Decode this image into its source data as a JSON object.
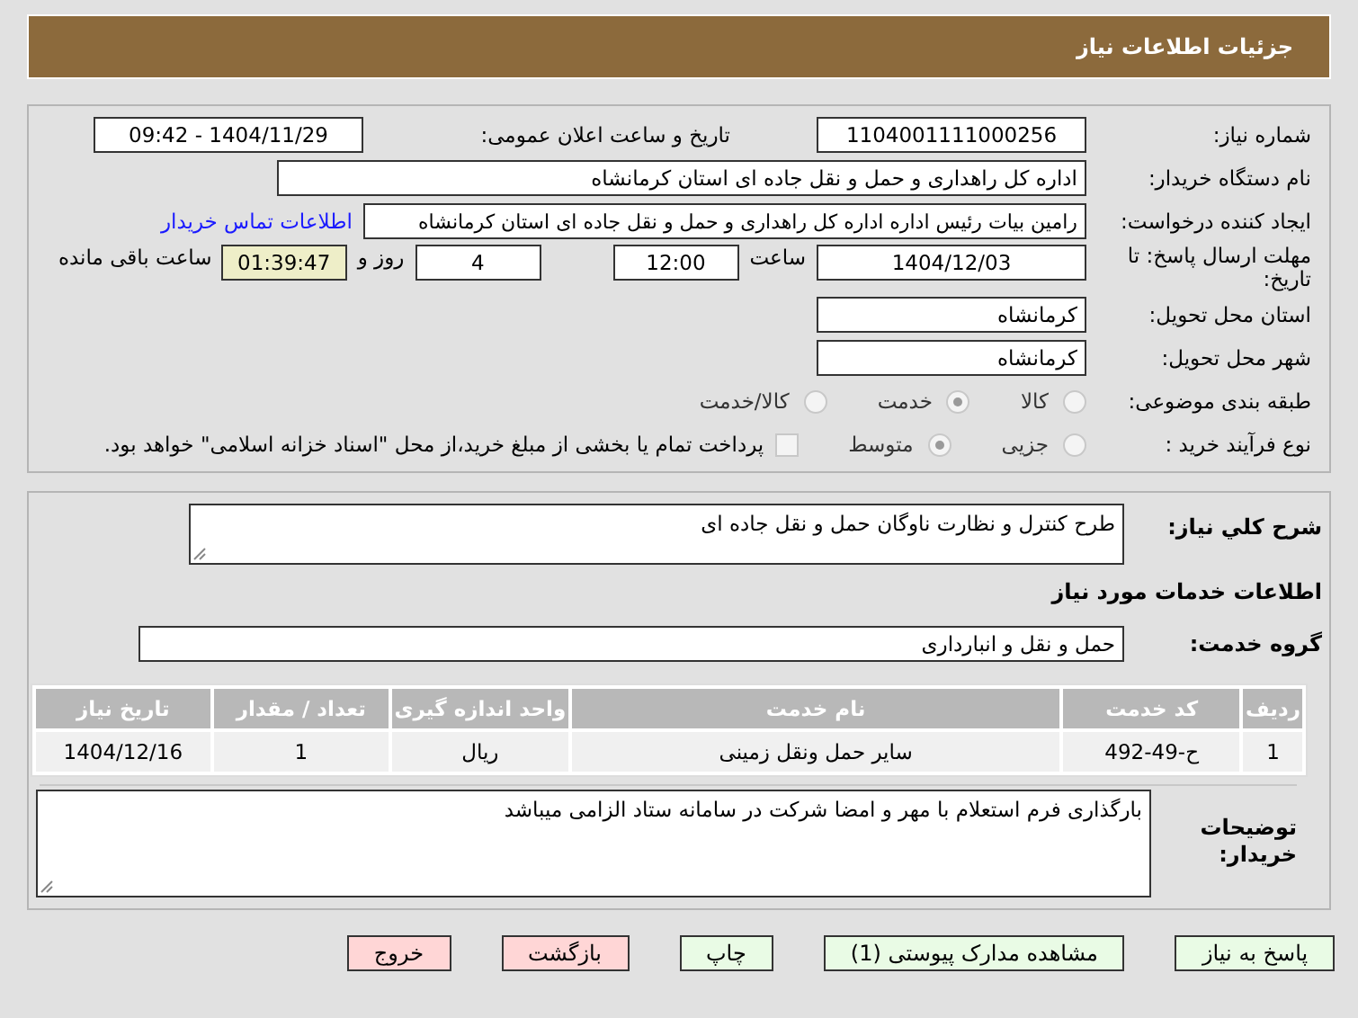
{
  "header": {
    "title": "جزئیات اطلاعات نیاز"
  },
  "details": {
    "need_number": {
      "label": "شماره نیاز:",
      "value": "1104001111000256"
    },
    "announce": {
      "label": "تاریخ و ساعت اعلان عمومی:",
      "value": "1404/11/29 - 09:42"
    },
    "buyer": {
      "label": "نام دستگاه خریدار:",
      "value": "اداره کل راهداری و حمل و نقل جاده ای استان کرمانشاه"
    },
    "creator": {
      "label": "ایجاد کننده درخواست:",
      "value": "رامین بیات رئیس اداره اداره کل راهداری و حمل و نقل جاده ای استان کرمانشاه",
      "link": "اطلاعات تماس خریدار"
    },
    "deadline": {
      "label": "مهلت ارسال پاسخ: تا تاریخ:",
      "date": "1404/12/03",
      "time_label": "ساعت",
      "time": "12:00",
      "days": "4",
      "days_label": "روز و",
      "remaining": "01:39:47",
      "remaining_label": "ساعت باقی مانده"
    },
    "province": {
      "label": "استان محل تحویل:",
      "value": "کرمانشاه"
    },
    "city": {
      "label": "شهر محل تحویل:",
      "value": "کرمانشاه"
    },
    "category": {
      "label": "طبقه بندی موضوعی:",
      "options": [
        {
          "label": "کالا",
          "selected": false
        },
        {
          "label": "خدمت",
          "selected": true
        },
        {
          "label": "کالا/خدمت",
          "selected": false
        }
      ]
    },
    "process": {
      "label": "نوع فرآیند خرید :",
      "options": [
        {
          "label": "جزیی",
          "selected": false
        },
        {
          "label": "متوسط",
          "selected": true
        }
      ],
      "payment": {
        "checked": false,
        "text": "پرداخت تمام یا بخشی از مبلغ خرید،از محل \"اسناد خزانه اسلامی\" خواهد بود."
      }
    }
  },
  "summary": {
    "label": "شرح کلي نياز:",
    "value": "طرح کنترل و نظارت ناوگان حمل و نقل جاده ای"
  },
  "services_title": "اطلاعات خدمات مورد نیاز",
  "service_group": {
    "label": "گروه خدمت:",
    "value": "حمل و نقل و انبارداری"
  },
  "table": {
    "columns": [
      "ردیف",
      "کد خدمت",
      "نام خدمت",
      "واحد اندازه گیری",
      "تعداد / مقدار",
      "تاریخ نیاز"
    ],
    "rows": [
      [
        "1",
        "ح-49-492",
        "سایر حمل ونقل زمینی",
        "ریال",
        "1",
        "1404/12/16"
      ]
    ]
  },
  "notes": {
    "label": "توضیحات خریدار:",
    "value": "بارگذاری فرم استعلام با مهر و امضا شرکت در سامانه ستاد الزامی میباشد"
  },
  "buttons": [
    {
      "label": "پاسخ به نیاز",
      "kind": "normal"
    },
    {
      "label": "مشاهده مدارک پیوستی (1)",
      "kind": "normal"
    },
    {
      "label": "چاپ",
      "kind": "normal"
    },
    {
      "label": "بازگشت",
      "kind": "danger"
    },
    {
      "label": "خروج",
      "kind": "danger"
    }
  ]
}
